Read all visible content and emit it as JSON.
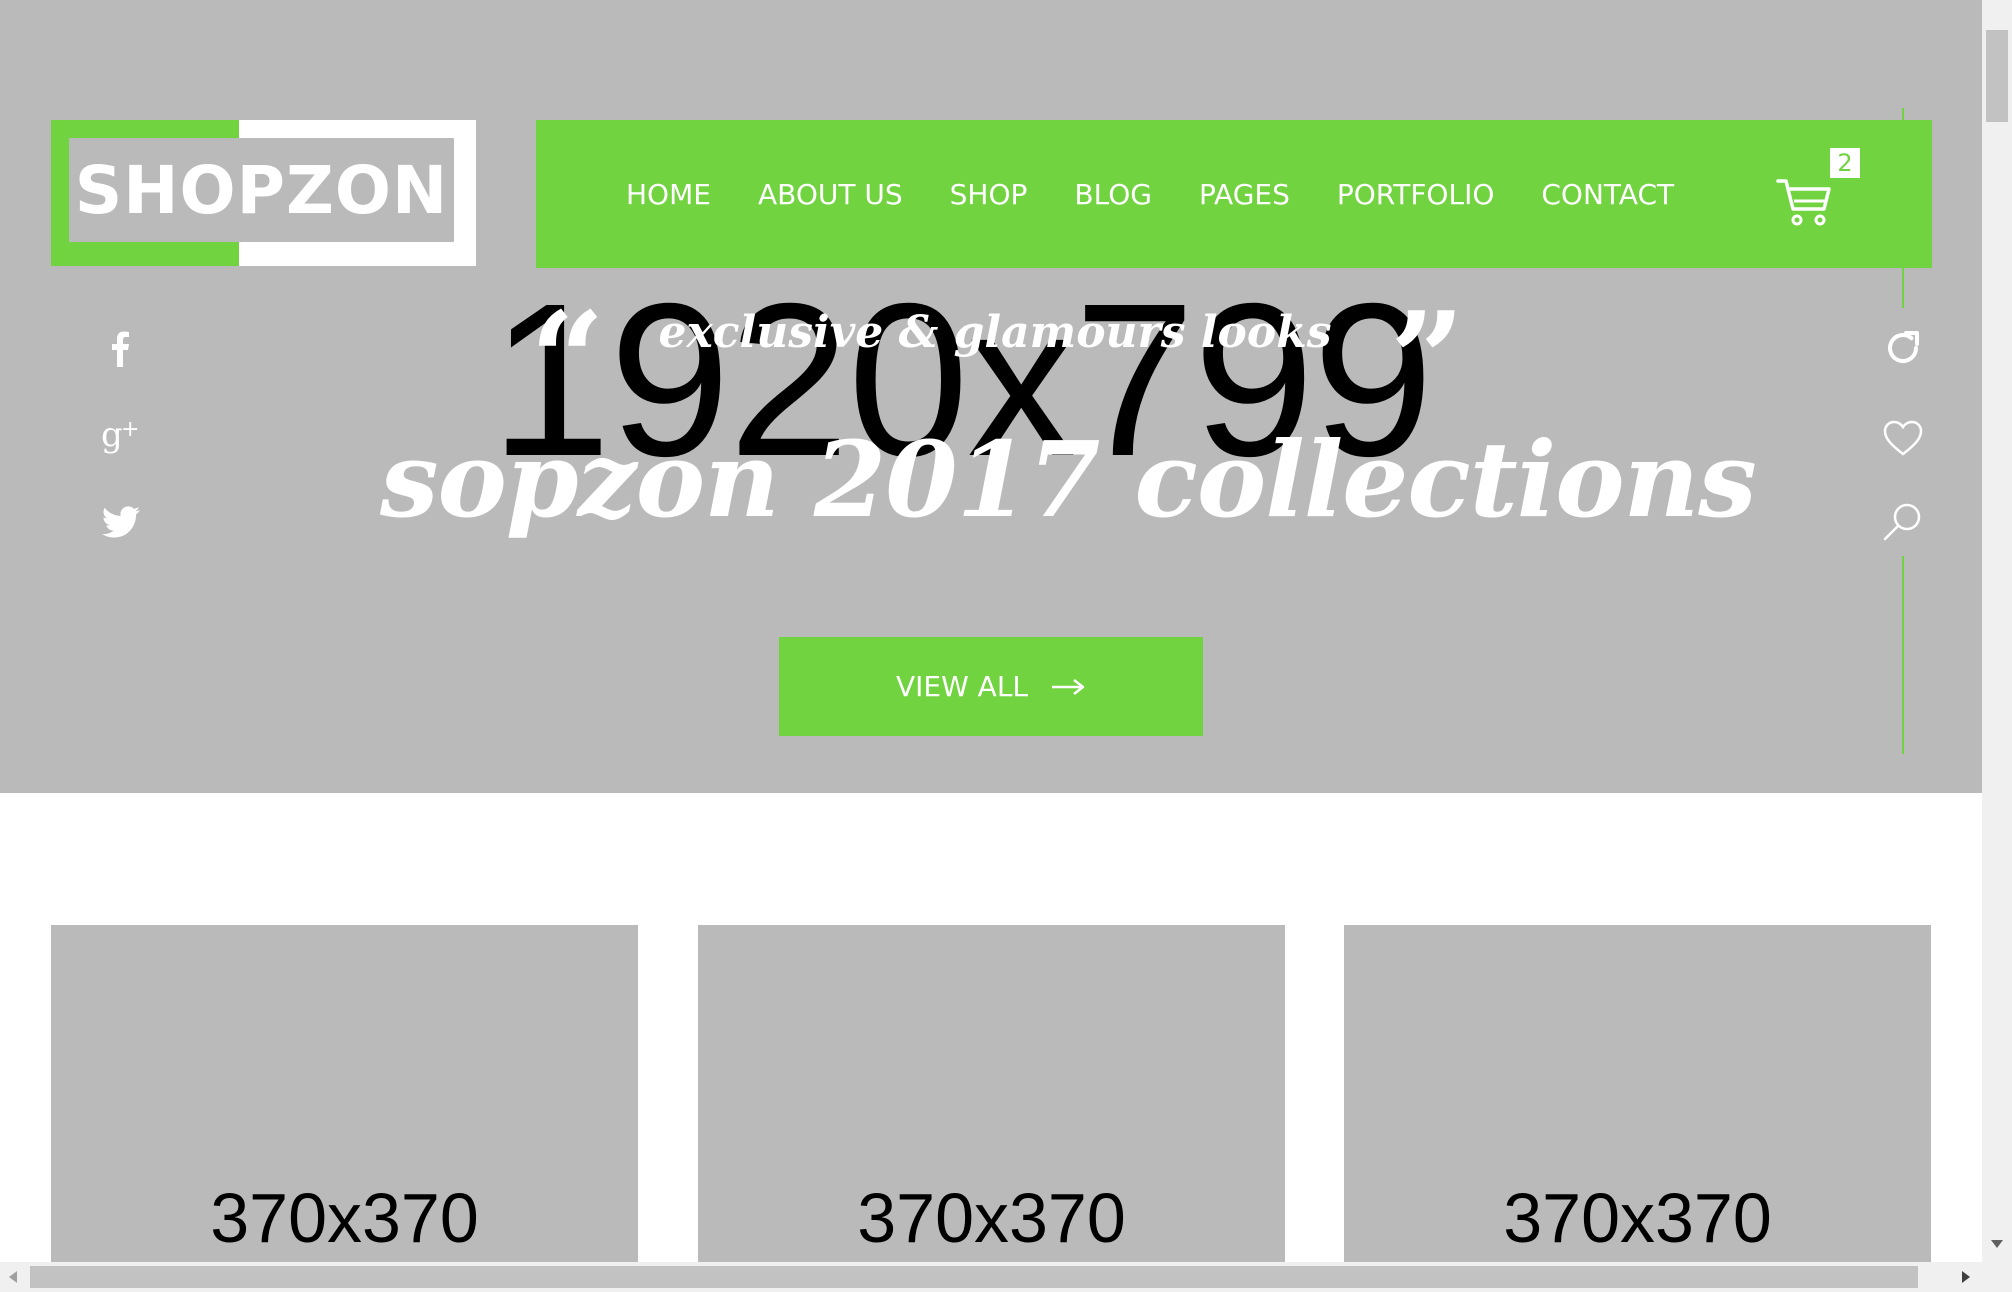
{
  "brand": {
    "logo_text": "SHOPZON"
  },
  "nav": {
    "items": [
      {
        "label": "HOME"
      },
      {
        "label": "ABOUT US"
      },
      {
        "label": "SHOP"
      },
      {
        "label": "BLOG"
      },
      {
        "label": "PAGES"
      },
      {
        "label": "PORTFOLIO"
      },
      {
        "label": "CONTACT"
      }
    ],
    "cart_count": "2"
  },
  "hero": {
    "placeholder": "1920x799",
    "quote_open": "“",
    "quote_close": "”",
    "tagline": "exclusive & glamours looks",
    "headline": "sopzon 2017 collections",
    "cta_label": "VIEW ALL"
  },
  "social_icons": [
    "facebook-icon",
    "google-plus-icon",
    "twitter-icon"
  ],
  "tool_icons": [
    "refresh-icon",
    "heart-icon",
    "search-icon"
  ],
  "cards": [
    {
      "placeholder": "370x370"
    },
    {
      "placeholder": "370x370"
    },
    {
      "placeholder": "370x370"
    }
  ],
  "colors": {
    "accent": "#71d33f",
    "placeholder_bg": "#bababa",
    "text_light": "#ffffff"
  }
}
